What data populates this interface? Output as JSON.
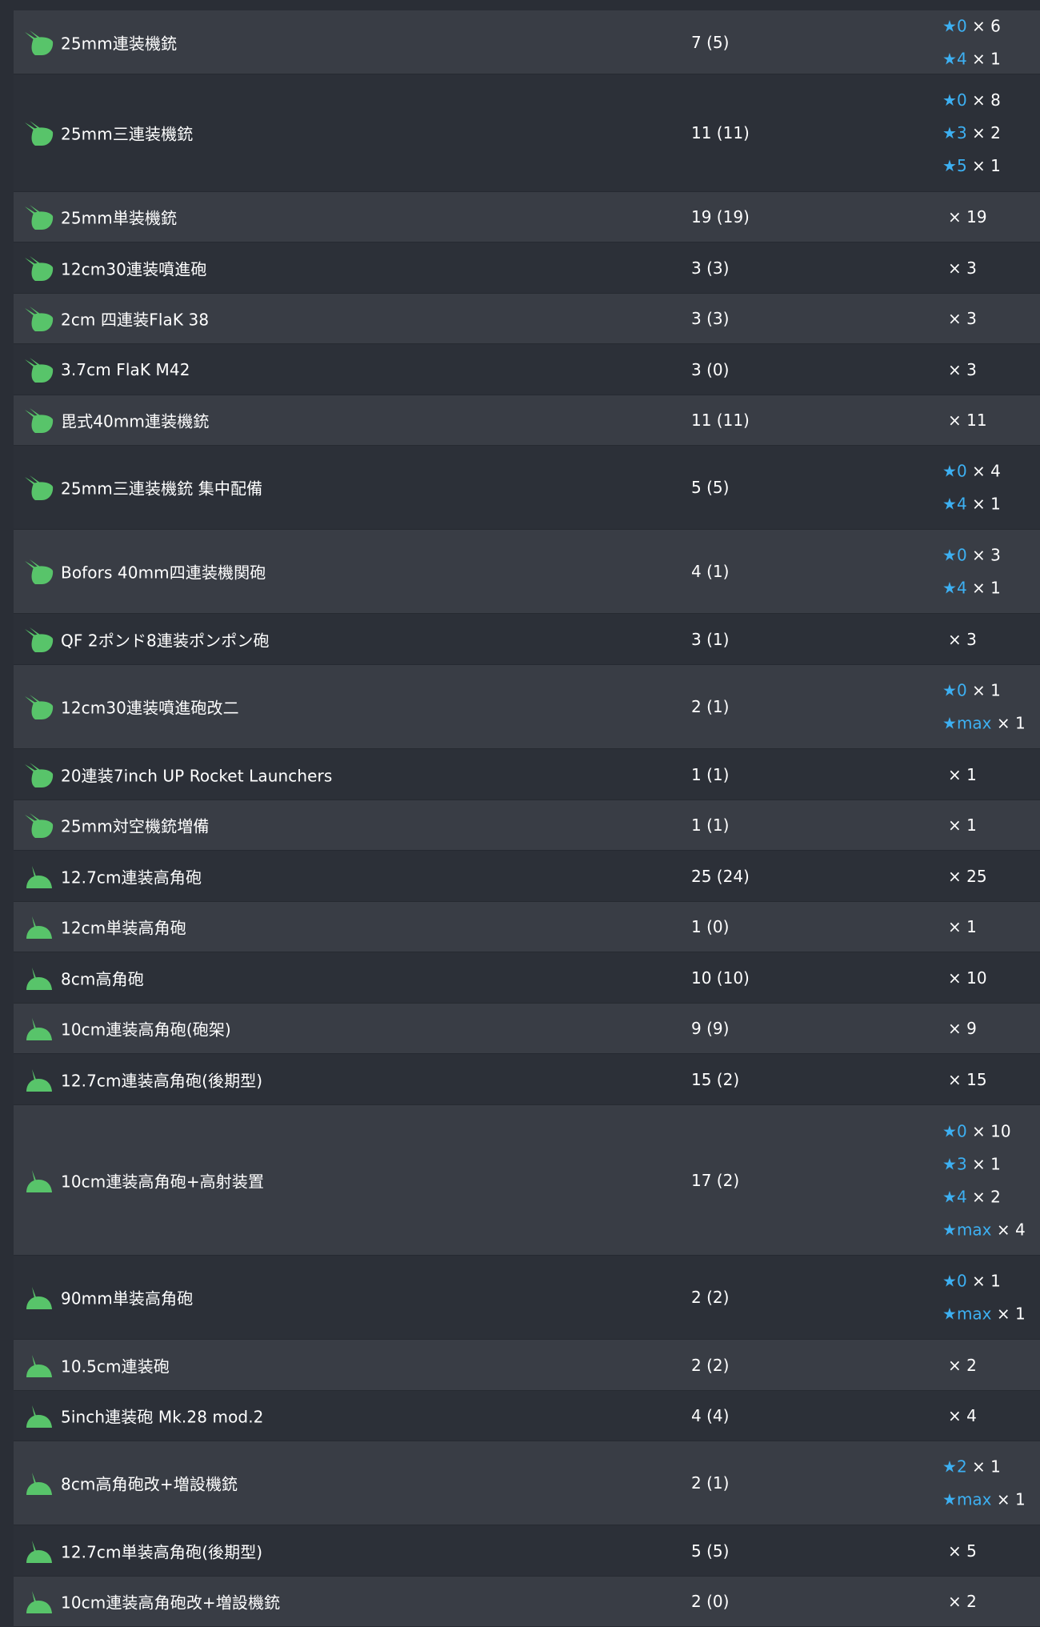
{
  "colors": {
    "row_odd": "#393d45",
    "row_even": "#2c3038",
    "star_accent": "#3db0f2",
    "icon_green": "#58c46a"
  },
  "rows": [
    {
      "icon": "aa-gun-icon",
      "name": "25mm連装機銃",
      "count": "7 (5)",
      "improvements": [
        {
          "star": "★",
          "level": "0",
          "mult": " × 6"
        },
        {
          "star": "★",
          "level": "4",
          "mult": " × 1"
        }
      ]
    },
    {
      "icon": "aa-gun-icon",
      "name": "25mm三連装機銃",
      "count": "11 (11)",
      "improvements": [
        {
          "star": "★",
          "level": "0",
          "mult": " × 8"
        },
        {
          "star": "★",
          "level": "3",
          "mult": " × 2"
        },
        {
          "star": "★",
          "level": "5",
          "mult": " × 1"
        }
      ]
    },
    {
      "icon": "aa-gun-icon",
      "name": "25mm単装機銃",
      "count": "19 (19)",
      "plain": "× 19"
    },
    {
      "icon": "aa-gun-icon",
      "name": "12cm30連装噴進砲",
      "count": "3 (3)",
      "plain": "× 3"
    },
    {
      "icon": "aa-gun-icon",
      "name": "2cm 四連装FlaK 38",
      "count": "3 (3)",
      "plain": "× 3"
    },
    {
      "icon": "aa-gun-icon",
      "name": "3.7cm FlaK M42",
      "count": "3 (0)",
      "plain": "× 3"
    },
    {
      "icon": "aa-gun-icon",
      "name": "毘式40mm連装機銃",
      "count": "11 (11)",
      "plain": "× 11"
    },
    {
      "icon": "aa-gun-icon",
      "name": "25mm三連装機銃 集中配備",
      "count": "5 (5)",
      "improvements": [
        {
          "star": "★",
          "level": "0",
          "mult": " × 4"
        },
        {
          "star": "★",
          "level": "4",
          "mult": " × 1"
        }
      ]
    },
    {
      "icon": "aa-gun-icon",
      "name": "Bofors 40mm四連装機関砲",
      "count": "4 (1)",
      "improvements": [
        {
          "star": "★",
          "level": "0",
          "mult": " × 3"
        },
        {
          "star": "★",
          "level": "4",
          "mult": " × 1"
        }
      ]
    },
    {
      "icon": "aa-gun-icon",
      "name": "QF 2ポンド8連装ポンポン砲",
      "count": "3 (1)",
      "plain": "× 3"
    },
    {
      "icon": "aa-gun-icon",
      "name": "12cm30連装噴進砲改二",
      "count": "2 (1)",
      "improvements": [
        {
          "star": "★",
          "level": "0",
          "mult": " × 1"
        },
        {
          "star": "★",
          "level": "max",
          "mult": " × 1"
        }
      ]
    },
    {
      "icon": "aa-gun-icon",
      "name": "20連装7inch UP Rocket Launchers",
      "count": "1 (1)",
      "plain": "× 1"
    },
    {
      "icon": "aa-gun-icon",
      "name": "25mm対空機銃増備",
      "count": "1 (1)",
      "plain": "× 1"
    },
    {
      "icon": "ha-gun-icon",
      "name": "12.7cm連装高角砲",
      "count": "25 (24)",
      "plain": "× 25"
    },
    {
      "icon": "ha-gun-icon",
      "name": "12cm単装高角砲",
      "count": "1 (0)",
      "plain": "× 1"
    },
    {
      "icon": "ha-gun-icon",
      "name": "8cm高角砲",
      "count": "10 (10)",
      "plain": "× 10"
    },
    {
      "icon": "ha-gun-icon",
      "name": "10cm連装高角砲(砲架)",
      "count": "9 (9)",
      "plain": "× 9"
    },
    {
      "icon": "ha-gun-icon",
      "name": "12.7cm連装高角砲(後期型)",
      "count": "15 (2)",
      "plain": "× 15"
    },
    {
      "icon": "ha-gun-icon",
      "name": "10cm連装高角砲+高射装置",
      "count": "17 (2)",
      "improvements": [
        {
          "star": "★",
          "level": "0",
          "mult": " × 10"
        },
        {
          "star": "★",
          "level": "3",
          "mult": " × 1"
        },
        {
          "star": "★",
          "level": "4",
          "mult": " × 2"
        },
        {
          "star": "★",
          "level": "max",
          "mult": " × 4"
        }
      ]
    },
    {
      "icon": "ha-gun-icon",
      "name": "90mm単装高角砲",
      "count": "2 (2)",
      "improvements": [
        {
          "star": "★",
          "level": "0",
          "mult": " × 1"
        },
        {
          "star": "★",
          "level": "max",
          "mult": " × 1"
        }
      ]
    },
    {
      "icon": "ha-gun-icon",
      "name": "10.5cm連装砲",
      "count": "2 (2)",
      "plain": "× 2"
    },
    {
      "icon": "ha-gun-icon",
      "name": "5inch連装砲 Mk.28 mod.2",
      "count": "4 (4)",
      "plain": "× 4"
    },
    {
      "icon": "ha-gun-icon",
      "name": "8cm高角砲改+増設機銃",
      "count": "2 (1)",
      "improvements": [
        {
          "star": "★",
          "level": "2",
          "mult": " × 1"
        },
        {
          "star": "★",
          "level": "max",
          "mult": " × 1"
        }
      ]
    },
    {
      "icon": "ha-gun-icon",
      "name": "12.7cm単装高角砲(後期型)",
      "count": "5 (5)",
      "plain": "× 5"
    },
    {
      "icon": "ha-gun-icon",
      "name": "10cm連装高角砲改+増設機銃",
      "count": "2 (0)",
      "plain": "× 2"
    }
  ]
}
